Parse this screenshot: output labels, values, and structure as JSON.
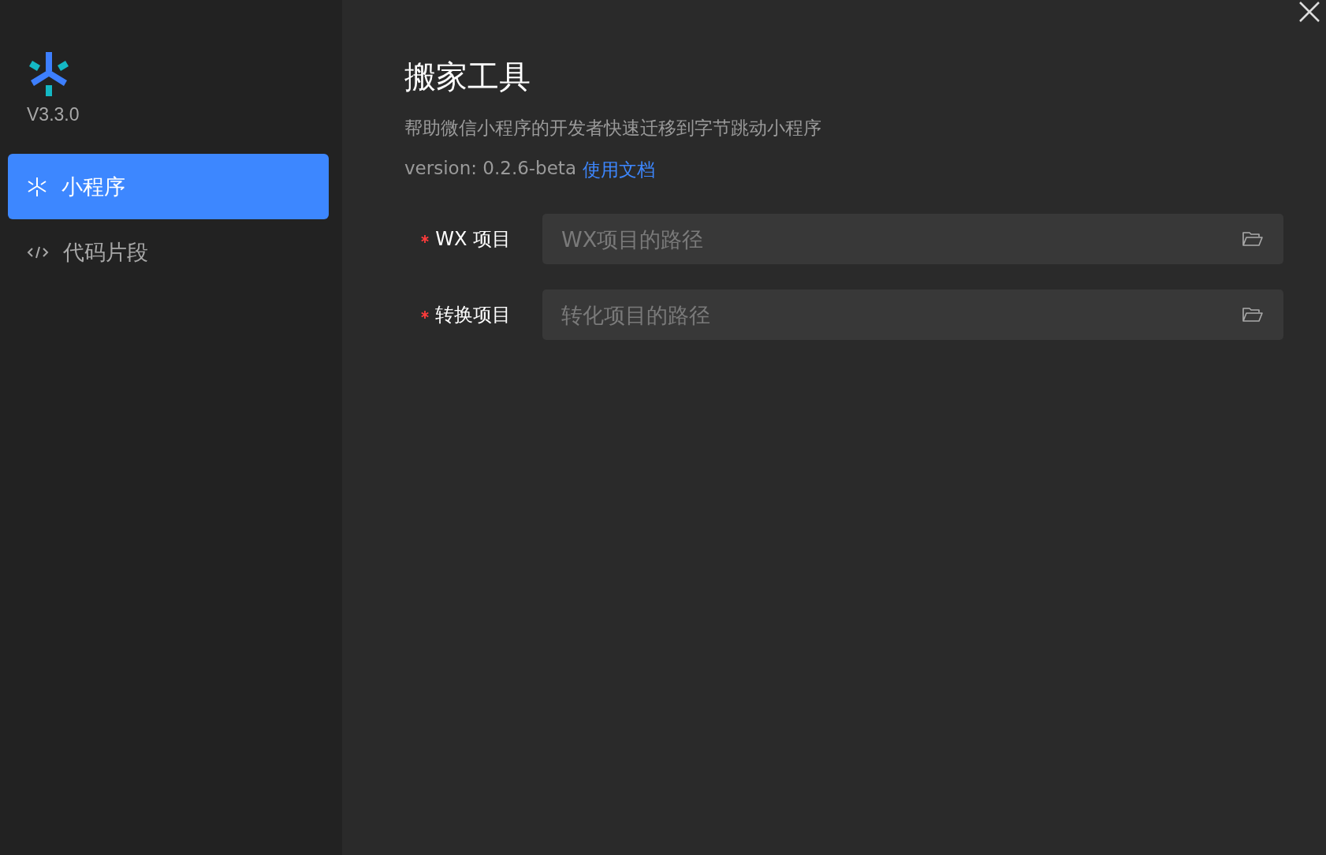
{
  "sidebar": {
    "version": "V3.3.0",
    "items": [
      {
        "label": "小程序",
        "kind": "asterisk",
        "selected": true
      },
      {
        "label": "代码片段",
        "kind": "code",
        "selected": false
      }
    ]
  },
  "main": {
    "title": "搬家工具",
    "description": "帮助微信小程序的开发者快速迁移到字节跳动小程序",
    "version": "version: 0.2.6-beta",
    "doc_link": "使用文档",
    "fields": [
      {
        "label": "WX 项目",
        "required": true,
        "placeholder": "WX项目的路径"
      },
      {
        "label": "转换项目",
        "required": true,
        "placeholder": "转化项目的路径"
      }
    ]
  }
}
